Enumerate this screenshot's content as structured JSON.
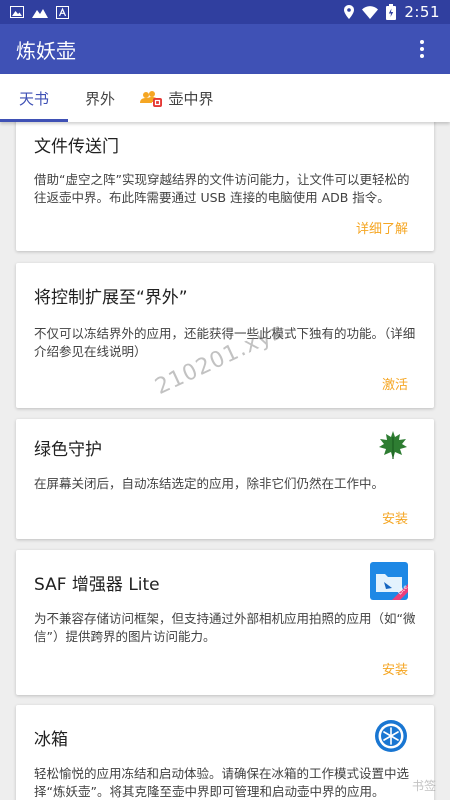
{
  "status_bar": {
    "time": "2:51",
    "icons_left": [
      "image-icon",
      "mountain-icon",
      "font-icon"
    ],
    "icons_right": [
      "location-icon",
      "wifi-icon",
      "battery-icon"
    ]
  },
  "app_bar": {
    "title": "炼妖壶",
    "menu_icon": "more-vertical-icon"
  },
  "tabs": [
    {
      "label": "天书",
      "selected": true
    },
    {
      "label": "界外",
      "selected": false
    },
    {
      "label": "壶中界",
      "selected": false,
      "icon": "shared-profile-icon"
    }
  ],
  "cards": [
    {
      "title": "文件传送门",
      "desc": "借助“虚空之阵”实现穿越结界的文件访问能力，让文件可以更轻松的往返壶中界。布此阵需要通过 USB 连接的电脑使用 ADB 指令。",
      "action": "详细了解"
    },
    {
      "title": "将控制扩展至“界外”",
      "desc": "不仅可以冻结界外的应用，还能获得一些此模式下独有的功能。（详细介绍参见在线说明）",
      "action": "激活"
    },
    {
      "title": "绿色守护",
      "desc": "在屏幕关闭后，自动冻结选定的应用，除非它们仍然在工作中。",
      "action": "安装",
      "icon": "green-leaf-icon"
    },
    {
      "title": "SAF 增强器 Lite",
      "desc": "为不兼容存储访问框架，但支持通过外部相机应用拍照的应用（如“微信”）提供跨界的图片访问能力。",
      "action": "安装",
      "icon": "saf-folder-icon",
      "icon_badge": "Lite"
    },
    {
      "title": "冰箱",
      "desc": "轻松愉悦的应用冻结和启动体验。请确保在冰箱的工作模式设置中选择“炼妖壶”。将其克隆至壶中界即可管理和启动壶中界的应用。",
      "icon": "snowflake-icon"
    }
  ],
  "watermark": "210201.xyz",
  "corner_watermark": "书签",
  "colors": {
    "primary": "#3f51b5",
    "primary_dark": "#303f9f",
    "accent": "#f5a623",
    "background": "#eeeeee"
  }
}
